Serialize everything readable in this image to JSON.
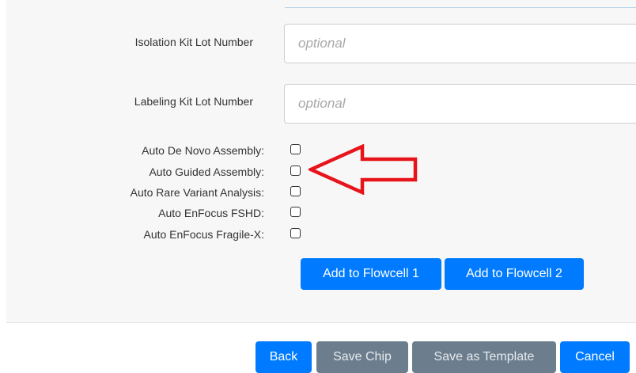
{
  "form": {
    "isolation_label": "Isolation Kit Lot Number",
    "isolation_placeholder": "optional",
    "labeling_label": "Labeling Kit Lot Number",
    "labeling_placeholder": "optional",
    "checkboxes": [
      {
        "label": "Auto De Novo Assembly:",
        "checked": false
      },
      {
        "label": "Auto Guided Assembly:",
        "checked": false
      },
      {
        "label": "Auto Rare Variant Analysis:",
        "checked": false
      },
      {
        "label": "Auto EnFocus FSHD:",
        "checked": false
      },
      {
        "label": "Auto EnFocus Fragile-X:",
        "checked": false
      }
    ],
    "add_flowcell_1": "Add to Flowcell 1",
    "add_flowcell_2": "Add to Flowcell 2"
  },
  "footer": {
    "back": "Back",
    "save_chip": "Save Chip",
    "save_template": "Save as Template",
    "cancel": "Cancel"
  },
  "colors": {
    "primary": "#007bff",
    "disabled": "#6c7e8d",
    "annotation_arrow": "#e8141b"
  },
  "annotation": {
    "icon": "left-arrow-icon"
  }
}
